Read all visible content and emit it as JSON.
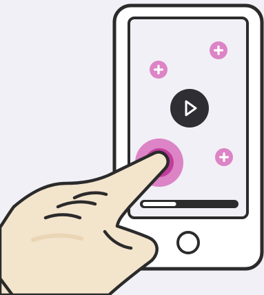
{
  "illustration": {
    "subject": "hand-tapping-phone-game",
    "colors": {
      "background": "#f1f0f6",
      "phone_body": "#ffffff",
      "outline": "#2b2b2b",
      "screen": "#f1f0f6",
      "accent_pink": "#dc84c6",
      "accent_pink_dark": "#c23c9b",
      "accent_pink_light": "#e7a6d9",
      "play_button": "#2e2e33",
      "skin": "#f3e4cc",
      "skin_shade": "#ead5b4"
    },
    "icons": [
      "phone-icon",
      "play-icon",
      "plus-icon",
      "tap-target-icon",
      "progress-bar",
      "home-button-icon",
      "hand-icon"
    ],
    "progress": {
      "value": 0.36
    }
  }
}
